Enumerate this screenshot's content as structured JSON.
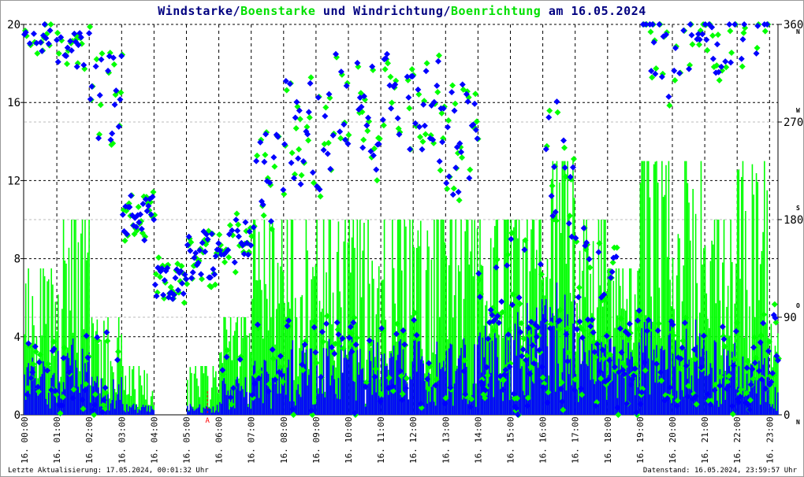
{
  "title": {
    "part1": "Windstarke",
    "sep1": "/",
    "part2": "Boenstarke",
    "part3": " und ",
    "part4": "Windrichtung",
    "sep2": "/",
    "part5": "Boenrichtung",
    "part6": " am 16.05.2024"
  },
  "footer": {
    "left": "Letzte Aktualisierung: 17.05.2024, 00:01:32 Uhr",
    "right": "Datenstand: 16.05.2024, 23:59:57 Uhr"
  },
  "colors": {
    "wind": "#0000ff",
    "gust": "#00ff00",
    "marker": "#ff0000"
  },
  "chart_data": {
    "type": "scatter",
    "title": "Windstarke/Boenstarke und Windrichtung/Boenrichtung am 16.05.2024",
    "y_left": {
      "range": [
        0,
        20
      ],
      "ticks": [
        "0",
        "4",
        "8",
        "12",
        "16",
        "20"
      ]
    },
    "y_right": {
      "range": [
        0,
        360
      ],
      "ticks": [
        "0",
        "90",
        "180",
        "270",
        "360"
      ],
      "compass": [
        "N",
        "O",
        "S",
        "W",
        "N"
      ]
    },
    "x_ticks": [
      "16. 00:00",
      "16. 01:00",
      "16. 02:00",
      "16. 03:00",
      "16. 04:00",
      "16. 05:00",
      "16. 06:00",
      "16. 07:00",
      "16. 08:00",
      "16. 09:00",
      "16. 10:00",
      "16. 11:00",
      "16. 12:00",
      "16. 13:00",
      "16. 14:00",
      "16. 15:00",
      "16. 16:00",
      "16. 17:00",
      "16. 18:00",
      "16. 19:00",
      "16. 20:00",
      "16. 21:00",
      "16. 22:00",
      "16. 23:00"
    ],
    "marker": {
      "label": "A",
      "hour": 5.65
    },
    "hourly": {
      "direction_deg": [
        345,
        340,
        300,
        180,
        120,
        150,
        160,
        220,
        260,
        270,
        270,
        290,
        280,
        250,
        100,
        100,
        220,
        110,
        80,
        340,
        345,
        345,
        340,
        90
      ],
      "direction_spread": [
        20,
        25,
        60,
        30,
        20,
        30,
        25,
        60,
        70,
        80,
        70,
        60,
        60,
        70,
        90,
        80,
        90,
        80,
        90,
        60,
        40,
        40,
        40,
        50
      ],
      "low_direction_share": [
        0.5,
        0.4,
        0.3,
        0,
        0,
        0,
        0.2,
        0.3,
        0.3,
        0.3,
        0.3,
        0.3,
        0.3,
        0.3,
        0.5,
        0.5,
        0.4,
        0.6,
        0.7,
        0.5,
        0.5,
        0.5,
        0.6,
        0.6
      ],
      "mean_speed": [
        1.5,
        2,
        1,
        0.3,
        0,
        0.3,
        1,
        1.5,
        2,
        2,
        2,
        2,
        2,
        2,
        2.5,
        3,
        3.5,
        2,
        2,
        2.5,
        2.5,
        2,
        2,
        1
      ],
      "max_gust": [
        7.5,
        10,
        5,
        2.5,
        0,
        2.5,
        5,
        10,
        10,
        10,
        10,
        10,
        10,
        10,
        10,
        10,
        13,
        10,
        7.5,
        13,
        13,
        10,
        13,
        5
      ]
    }
  }
}
